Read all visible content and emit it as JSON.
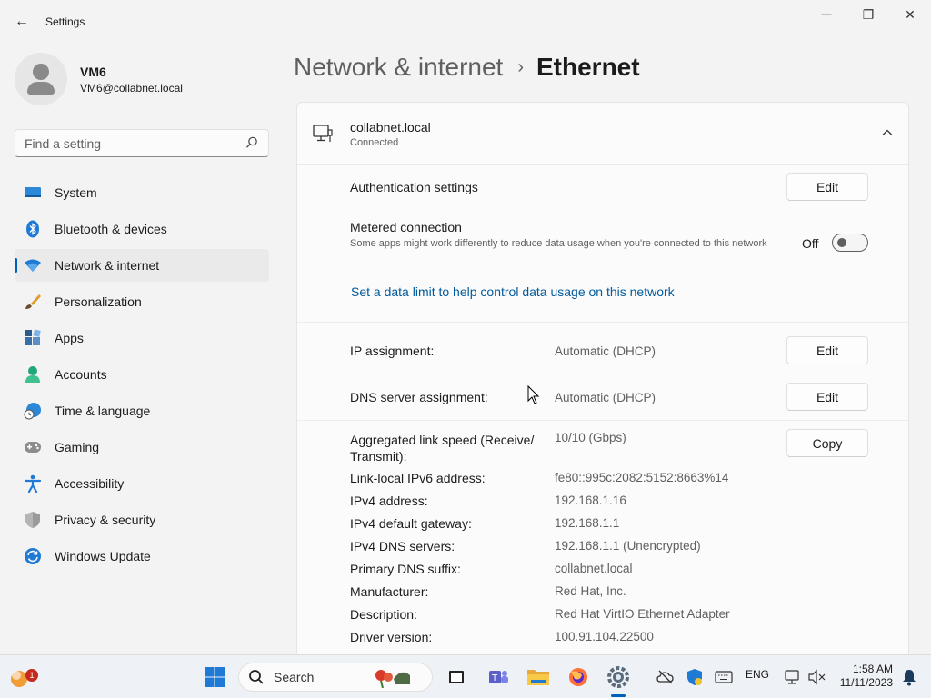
{
  "window": {
    "app_title": "Settings",
    "back_icon": "←",
    "minimize_icon": "—",
    "maximize_icon": "❐",
    "close_icon": "✕"
  },
  "profile": {
    "name": "VM6",
    "email": "VM6@collabnet.local"
  },
  "search": {
    "placeholder": "Find a setting"
  },
  "sidebar": {
    "items": [
      {
        "label": "System",
        "icon": "system-icon"
      },
      {
        "label": "Bluetooth & devices",
        "icon": "bluetooth-icon"
      },
      {
        "label": "Network & internet",
        "icon": "network-icon",
        "active": true
      },
      {
        "label": "Personalization",
        "icon": "brush-icon"
      },
      {
        "label": "Apps",
        "icon": "apps-icon"
      },
      {
        "label": "Accounts",
        "icon": "accounts-icon"
      },
      {
        "label": "Time & language",
        "icon": "globe-clock-icon"
      },
      {
        "label": "Gaming",
        "icon": "gamepad-icon"
      },
      {
        "label": "Accessibility",
        "icon": "accessibility-icon"
      },
      {
        "label": "Privacy & security",
        "icon": "shield-icon"
      },
      {
        "label": "Windows Update",
        "icon": "update-icon"
      }
    ]
  },
  "breadcrumb": {
    "parent": "Network & internet",
    "separator": "›",
    "current": "Ethernet"
  },
  "network": {
    "name": "collabnet.local",
    "status": "Connected"
  },
  "settings": {
    "auth_label": "Authentication settings",
    "edit_label": "Edit",
    "metered_label": "Metered connection",
    "metered_desc": "Some apps might work differently to reduce data usage when you're connected to this network",
    "metered_state": "Off",
    "metered_on": false,
    "data_limit_link": "Set a data limit to help control data usage on this network",
    "ip_assignment_label": "IP assignment:",
    "ip_assignment_value": "Automatic (DHCP)",
    "dns_assignment_label": "DNS server assignment:",
    "dns_assignment_value": "Automatic (DHCP)",
    "copy_label": "Copy"
  },
  "properties": [
    {
      "label": "Aggregated link speed (Receive/ Transmit):",
      "value": "10/10 (Gbps)"
    },
    {
      "label": "Link-local IPv6 address:",
      "value": "fe80::995c:2082:5152:8663%14"
    },
    {
      "label": "IPv4 address:",
      "value": "192.168.1.16"
    },
    {
      "label": "IPv4 default gateway:",
      "value": "192.168.1.1"
    },
    {
      "label": "IPv4 DNS servers:",
      "value": "192.168.1.1 (Unencrypted)"
    },
    {
      "label": "Primary DNS suffix:",
      "value": "collabnet.local"
    },
    {
      "label": "Manufacturer:",
      "value": "Red Hat, Inc."
    },
    {
      "label": "Description:",
      "value": "Red Hat VirtIO Ethernet Adapter"
    },
    {
      "label": "Driver version:",
      "value": "100.91.104.22500"
    }
  ],
  "taskbar": {
    "search_label": "Search",
    "notification_count": "1",
    "language": "ENG",
    "time": "1:58 AM",
    "date": "11/11/2023"
  },
  "colors": {
    "accent": "#005fb8",
    "link": "#005a9e",
    "background": "#f3f3f3"
  }
}
